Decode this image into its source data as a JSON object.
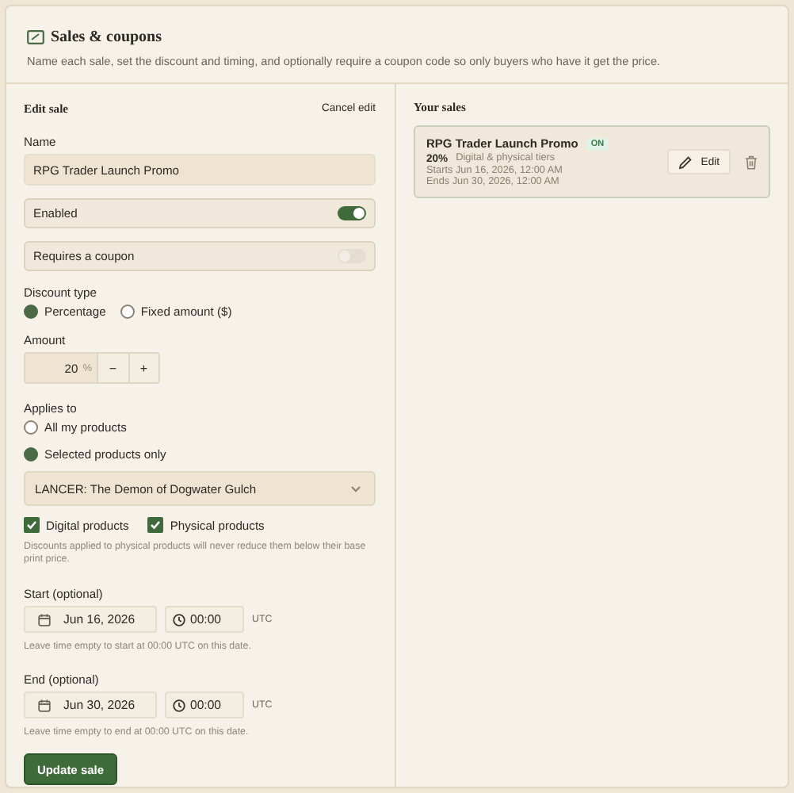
{
  "header": {
    "title": "Sales & coupons",
    "description": "Name each sale, set the discount and timing, and optionally require a coupon code so only buyers who have it get the price."
  },
  "edit_form": {
    "title": "Edit sale",
    "cancel_link": "Cancel edit",
    "name_field": {
      "label": "Name",
      "value": "RPG Trader Launch Promo"
    },
    "toggles": [
      {
        "label": "Enabled",
        "on": true
      },
      {
        "label": "Requires a coupon",
        "on": false
      }
    ],
    "discount_type": {
      "label": "Discount type",
      "options": [
        {
          "label": "Percentage",
          "selected": true
        },
        {
          "label": "Fixed amount ($)",
          "selected": false
        }
      ]
    },
    "amount": {
      "label": "Amount",
      "value": "20",
      "unit": "%",
      "decrement": "−",
      "increment": "+"
    },
    "applies_to": {
      "label": "Applies to",
      "options": [
        {
          "label": "All my products",
          "selected": false
        },
        {
          "label": "Selected products only",
          "selected": true
        }
      ]
    },
    "product_select": {
      "value": "LANCER: The Demon of Dogwater Gulch"
    },
    "product_types": [
      {
        "label": "Digital products",
        "checked": true
      },
      {
        "label": "Physical products",
        "checked": true
      }
    ],
    "note": "Discounts applied to physical products will never reduce them below their base print price.",
    "schedule": [
      {
        "label": "Start (optional)",
        "date": "Jun 16, 2026",
        "time": "00:00",
        "timezone": "UTC",
        "hint": "Leave time empty to start at 00:00 UTC on this date."
      },
      {
        "label": "End (optional)",
        "date": "Jun 30, 2026",
        "time": "00:00",
        "timezone": "UTC",
        "hint": "Leave time empty to end at 00:00 UTC on this date."
      }
    ],
    "submit": "Update sale"
  },
  "sales": {
    "title": "Your sales",
    "items": [
      {
        "name": "RPG Trader Launch Promo",
        "status": "ON",
        "discount": "20%",
        "tiers": "Digital & physical tiers",
        "starts": "Starts Jun 16, 2026, 12:00 AM",
        "ends": "Ends Jun 30, 2026, 12:00 AM",
        "edit": "Edit"
      }
    ]
  }
}
